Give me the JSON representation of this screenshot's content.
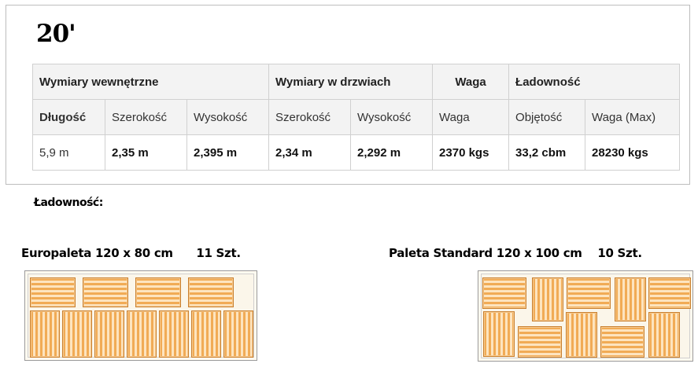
{
  "container_title": "20'",
  "table": {
    "groups": [
      "Wymiary wewnętrzne",
      "Wymiary w drzwiach",
      "Waga",
      "Ładowność"
    ],
    "subheaders": [
      "Długość",
      "Szerokość",
      "Wysokość",
      "Szerokość",
      "Wysokość",
      "Waga",
      "Objętość",
      "Waga (Max)"
    ],
    "values": [
      "5,9 m",
      "2,35 m",
      "2,395 m",
      "2,34 m",
      "2,292 m",
      "2370 kgs",
      "33,2 cbm",
      "28230 kgs"
    ]
  },
  "loading_title": "Ładowność:",
  "europallet": {
    "caption": "Europaleta 120 x 80 cm",
    "count": "11 Szt."
  },
  "standard_pallet": {
    "caption": "Paleta Standard 120 x 100 cm",
    "count": "10 Szt."
  },
  "colors": {
    "pallet_dark": "#f1ab55",
    "pallet_light": "#fde4bf",
    "pallet_border": "#c9802f"
  }
}
